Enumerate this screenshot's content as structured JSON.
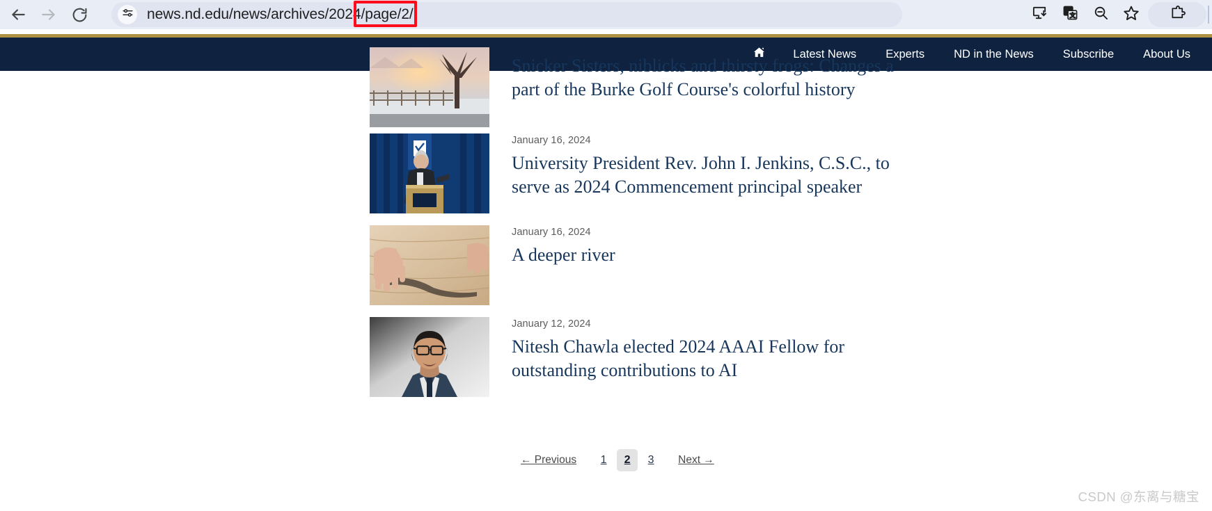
{
  "browser": {
    "back_icon": "arrow-left-icon",
    "forward_icon": "arrow-right-icon",
    "reload_icon": "reload-icon",
    "site_settings_icon": "tune-sliders-icon",
    "url": "news.nd.edu/news/archives/2024/page/2/",
    "url_prefix": "news.nd.edu/news/archives/2024",
    "url_highlighted": "/page/2/",
    "highlight_color": "#fc0d1b",
    "toolbar_icons": [
      {
        "name": "install-app-icon",
        "title": "Install page as app"
      },
      {
        "name": "translate-icon",
        "title": "Translate this page"
      },
      {
        "name": "zoom-out-icon",
        "title": "Zoom out"
      },
      {
        "name": "bookmark-star-icon",
        "title": "Bookmark this tab"
      },
      {
        "name": "extensions-puzzle-icon",
        "title": "Extensions"
      }
    ]
  },
  "site": {
    "accent_gold": "#ae9142",
    "navy": "#0f2340",
    "nav": [
      {
        "label": "",
        "name": "nav-home",
        "icon": "home-icon"
      },
      {
        "label": "Latest News",
        "name": "nav-latest-news"
      },
      {
        "label": "Experts",
        "name": "nav-experts"
      },
      {
        "label": "ND in the News",
        "name": "nav-nd-in-the-news"
      },
      {
        "label": "Subscribe",
        "name": "nav-subscribe"
      },
      {
        "label": "About Us",
        "name": "nav-about-us"
      }
    ]
  },
  "articles": [
    {
      "date": "",
      "title": "Snicker Sisters, niblicks and thirsty frogs: Changes a part of the Burke Golf Course's colorful history",
      "thumb": "winter-fence-sunrise-photo"
    },
    {
      "date": "January 16, 2024",
      "title": "University President Rev. John I. Jenkins, C.S.C., to serve as 2024 Commencement principal speaker",
      "thumb": "president-at-podium-photo"
    },
    {
      "date": "January 16, 2024",
      "title": "A deeper river",
      "thumb": "hands-on-wood-table-photo"
    },
    {
      "date": "January 12, 2024",
      "title": "Nitesh Chawla elected 2024 AAAI Fellow for outstanding contributions to AI",
      "thumb": "portrait-man-glasses-photo"
    }
  ],
  "pagination": {
    "previous_label": "← Previous",
    "next_label": "Next →",
    "pages": [
      "1",
      "2",
      "3"
    ],
    "current_page": "2"
  },
  "watermark": {
    "text": "CSDN @东离与糖宝"
  }
}
